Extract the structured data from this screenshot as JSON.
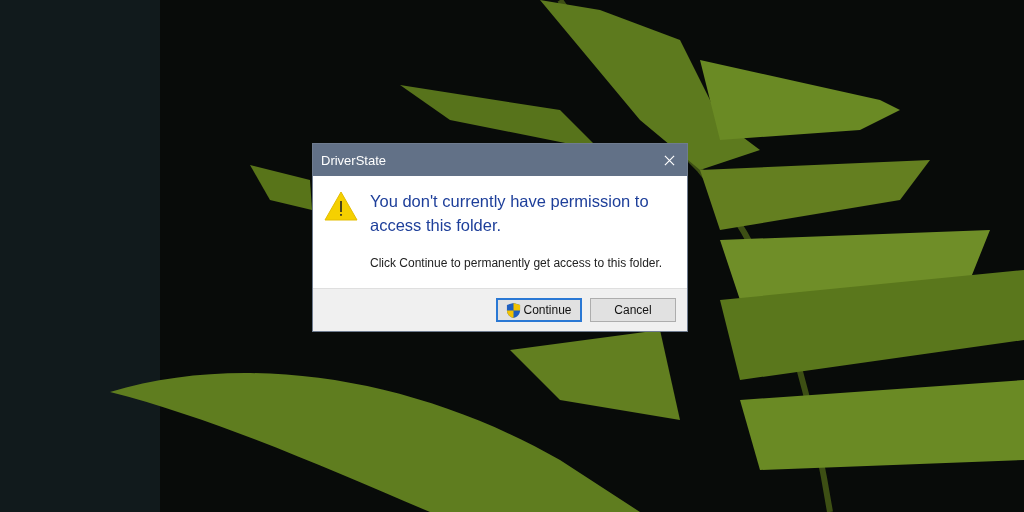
{
  "window": {
    "title": "DriverState"
  },
  "dialog": {
    "heading": "You don't currently have permission to access this folder.",
    "message": "Click Continue to permanently get access to this folder."
  },
  "buttons": [
    {
      "label": "Continue",
      "default": true,
      "shield": true
    },
    {
      "label": "Cancel",
      "default": false,
      "shield": false
    }
  ]
}
